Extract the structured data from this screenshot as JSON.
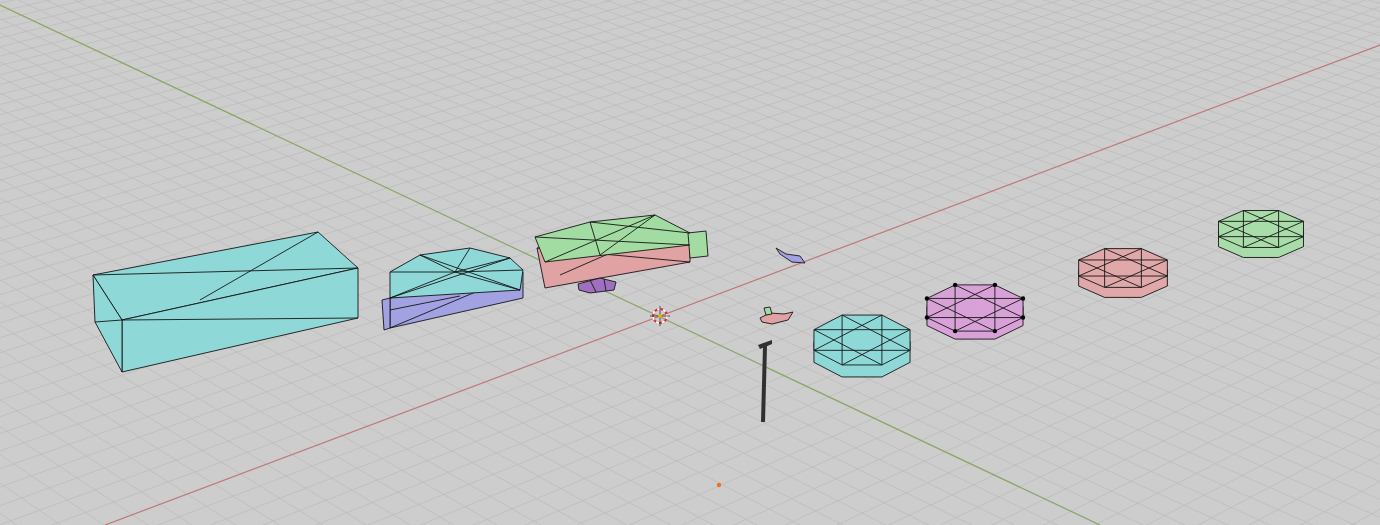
{
  "viewport": {
    "objects": [
      {
        "kind": "box",
        "color": "#8fd8d8"
      },
      {
        "kind": "box",
        "color": "#a2a2e2"
      },
      {
        "kind": "dome",
        "color": "#8fd8d8"
      },
      {
        "kind": "box",
        "color": "#e0a2a2"
      },
      {
        "kind": "box",
        "color": "#a2dca2"
      },
      {
        "kind": "vehicle",
        "color": "#a070c0"
      },
      {
        "kind": "aircraft",
        "color": "#a2a2e2"
      },
      {
        "kind": "aircraft",
        "color": "#e0a2a2"
      },
      {
        "kind": "lamp",
        "color": "#303030"
      },
      {
        "kind": "disc",
        "color": "#8fd8d8",
        "show_vertices": false
      },
      {
        "kind": "disc",
        "color": "#d8a2d8",
        "show_vertices": true
      },
      {
        "kind": "disc",
        "color": "#e0a8a8",
        "show_vertices": false
      },
      {
        "kind": "disc",
        "color": "#a8dca8",
        "show_vertices": false
      }
    ]
  }
}
